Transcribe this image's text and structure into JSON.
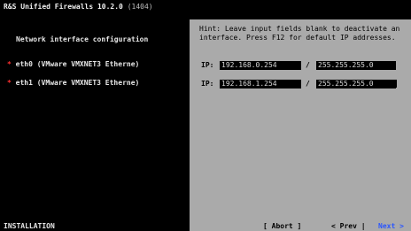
{
  "header": {
    "title": "R&S Unified Firewalls 10.2.0",
    "build": "(1404)"
  },
  "section_title": "Network interface configuration",
  "hint": "Hint: Leave input fields blank to deactivate an interface. Press F12 for default IP addresses.",
  "interfaces": [
    {
      "mark": "*",
      "label": "eth0 (VMware VMXNET3 Etherne)",
      "ip_label": "IP:",
      "ip": "192.168.0.254",
      "sep": "/",
      "netmask": "255.255.255.0"
    },
    {
      "mark": "*",
      "label": "eth1 (VMware VMXNET3 Etherne)",
      "ip_label": "IP:",
      "ip": "192.168.1.254",
      "sep": "/",
      "netmask": "255.255.255.0"
    }
  ],
  "status": "INSTALLATION",
  "buttons": {
    "abort": "[ Abort ]",
    "prev": "< Prev |",
    "next": "Next >"
  },
  "colors": {
    "background": "#000000",
    "panel": "#aaaaaa",
    "marker": "#ff3030",
    "next_button": "#2a56ff"
  }
}
